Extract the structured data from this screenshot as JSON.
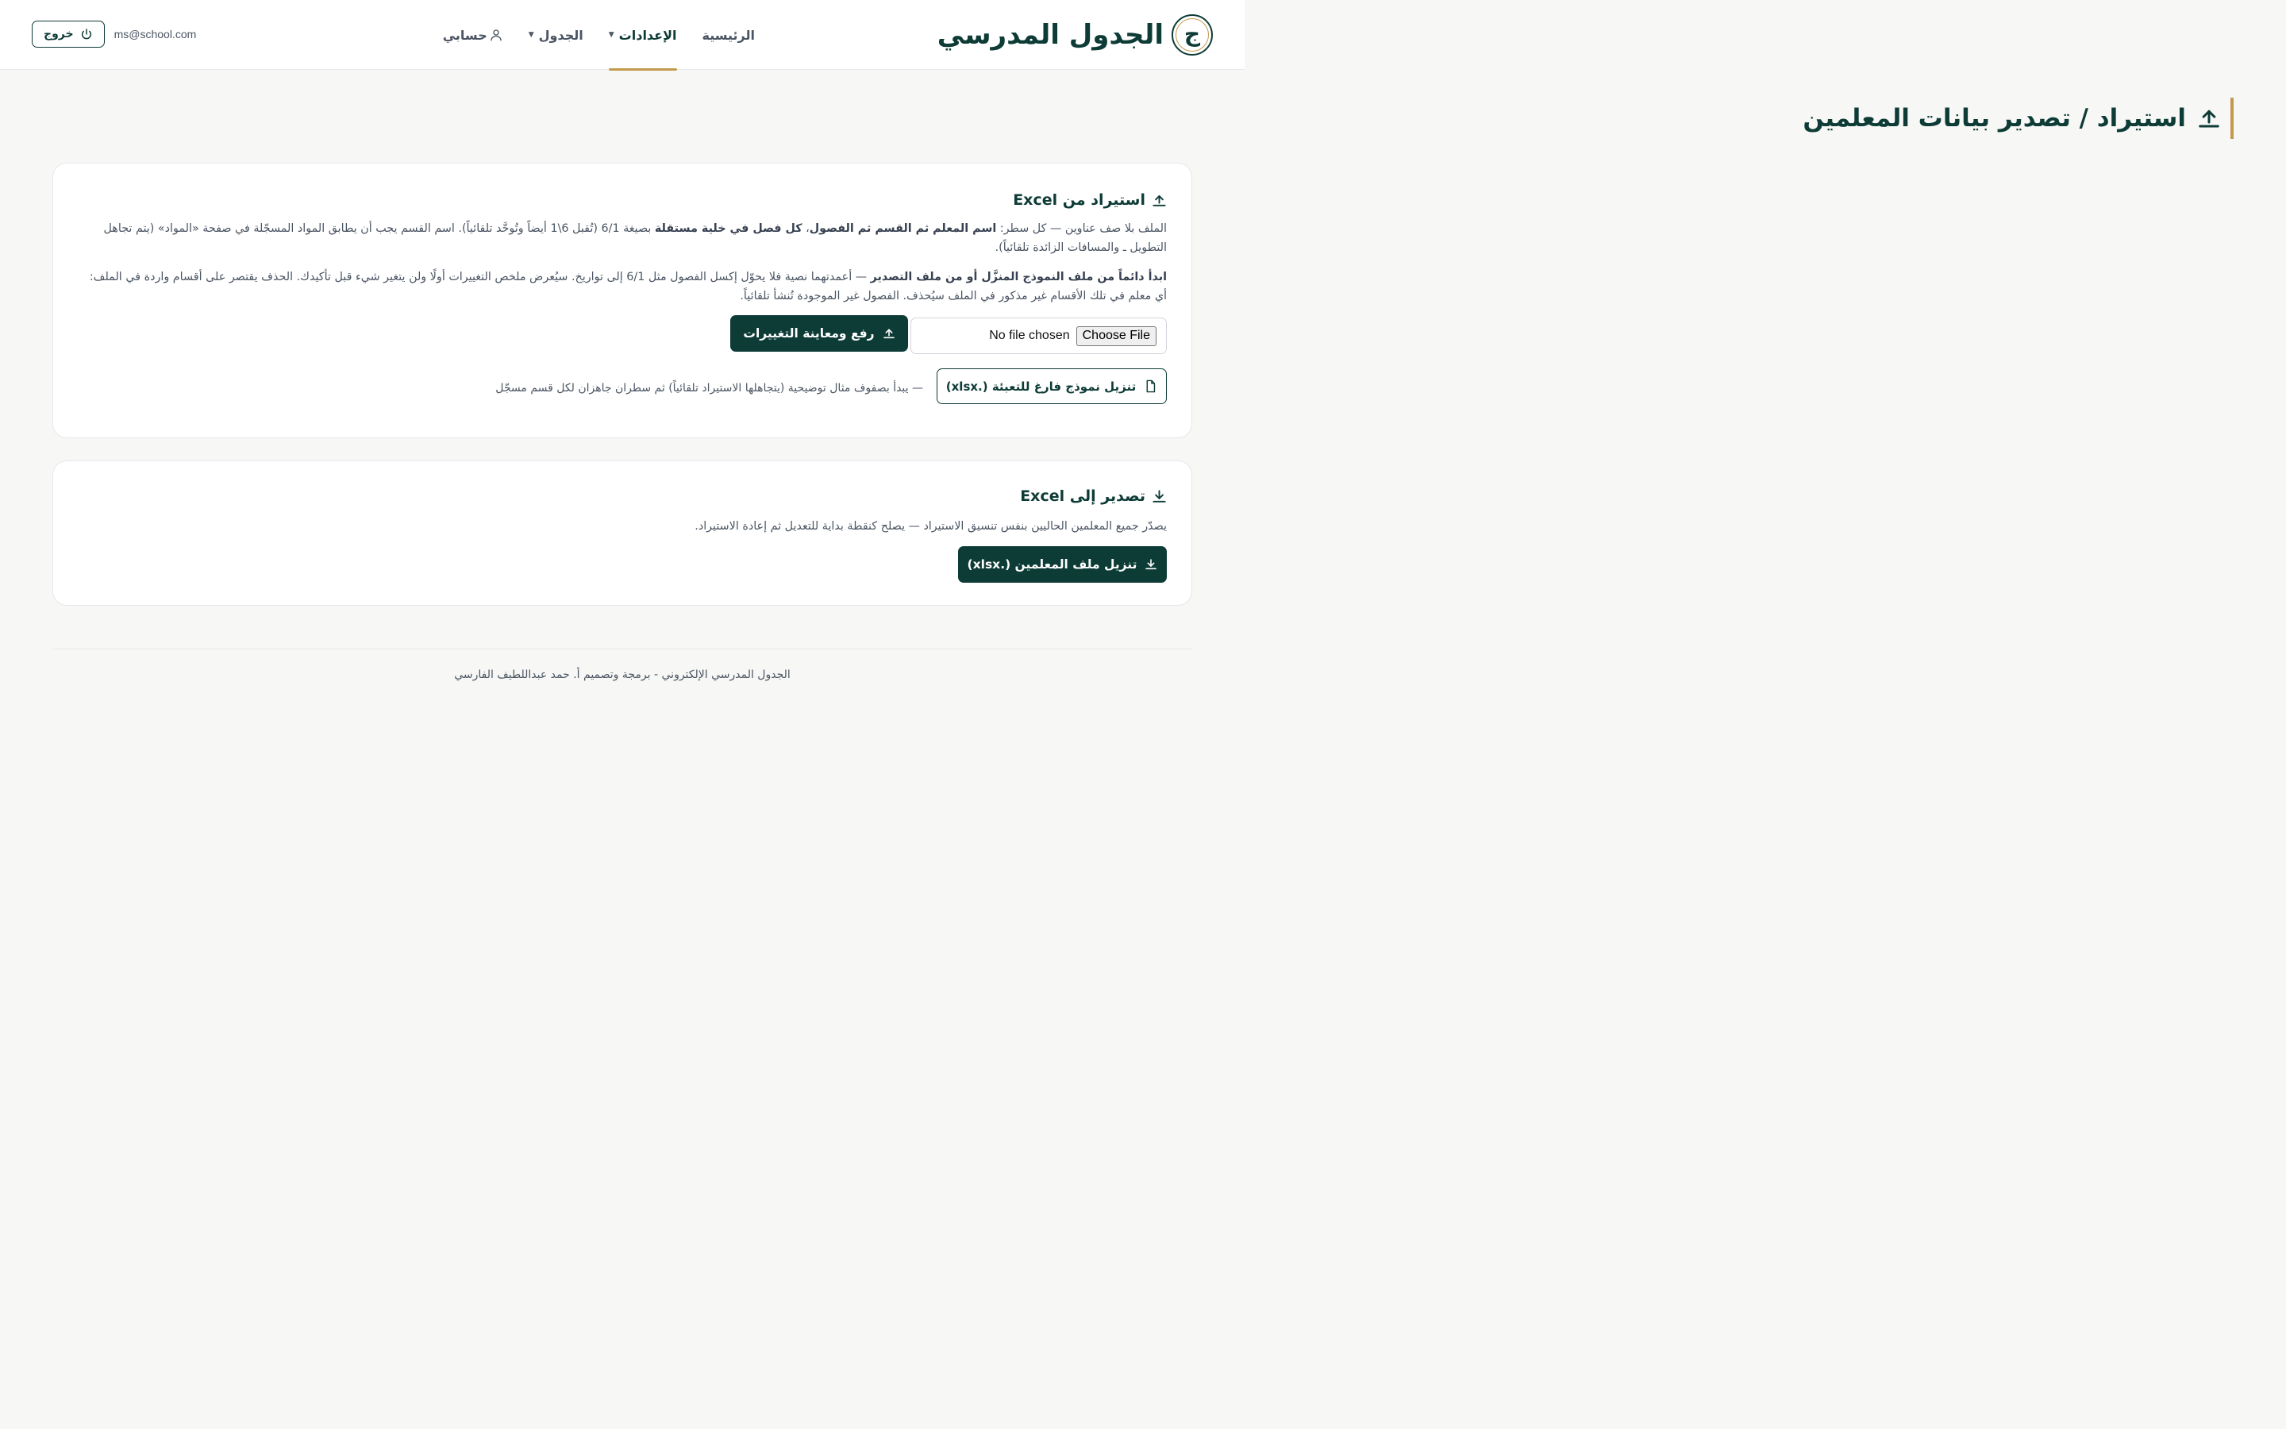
{
  "brand": {
    "logo_letter": "ج",
    "title": "الجدول المدرسي"
  },
  "nav": {
    "home": "الرئيسية",
    "settings": "الإعدادات",
    "schedule": "الجدول",
    "account": "حسابي"
  },
  "user": {
    "email": "ms@school.com",
    "logout": "خروج"
  },
  "page": {
    "title": "استيراد / تصدير بيانات المعلمين"
  },
  "import": {
    "heading": "استيراد من Excel",
    "p1_a": "الملف بلا صف عناوين — كل سطر: ",
    "p1_b": "اسم المعلم ثم القسم ثم الفصول",
    "p1_c": "، ",
    "p1_d": "كل فصل في خلية مستقلة",
    "p1_e": " بصيغة 6/1 (تُقبل 6\\1 أيضاً وتُوحَّد تلقائياً). اسم القسم يجب أن يطابق المواد المسجّلة في صفحة «المواد» (يتم تجاهل التطويل ـ والمسافات الزائدة تلقائياً).",
    "p2_a": "ابدأ دائماً من ملف النموذج المنزَّل أو من ملف التصدير",
    "p2_b": " — أعمدتهما نصية فلا يحوّل إكسل الفصول مثل 6/1 إلى تواريخ. سيُعرض ملخص التغييرات أولًا ولن يتغير شيء قبل تأكيدك. الحذف يقتصر على أقسام واردة في الملف: أي معلم في تلك الأقسام غير مذكور في الملف سيُحذف. الفصول غير الموجودة تُنشأ تلقائياً.",
    "choose_file": "Choose File",
    "no_file": "No file chosen",
    "upload_button": "رفع ومعاينة التغييرات",
    "template_button": "تنزيل نموذج فارغ للتعبئة (.xlsx)",
    "template_note": "— يبدأ بصفوف مثال توضيحية (يتجاهلها الاستيراد تلقائياً) ثم سطران جاهزان لكل قسم مسجّل"
  },
  "export": {
    "heading": "تصدير إلى Excel",
    "description": "يصدّر جميع المعلمين الحاليين بنفس تنسيق الاستيراد — يصلح كنقطة بداية للتعديل ثم إعادة الاستيراد.",
    "button": "تنزيل ملف المعلمين (.xlsx)"
  },
  "footer": {
    "text": "الجدول المدرسي الإلكتروني - برمجة وتصميم أ. حمد عبداللطيف الفارسي"
  },
  "colors": {
    "primary": "#0d3b36",
    "accent": "#c39a4b",
    "muted": "#4b5563"
  },
  "icons": [
    "upload-icon",
    "download-icon",
    "file-icon",
    "user-icon",
    "power-icon",
    "chevron-down-icon"
  ]
}
